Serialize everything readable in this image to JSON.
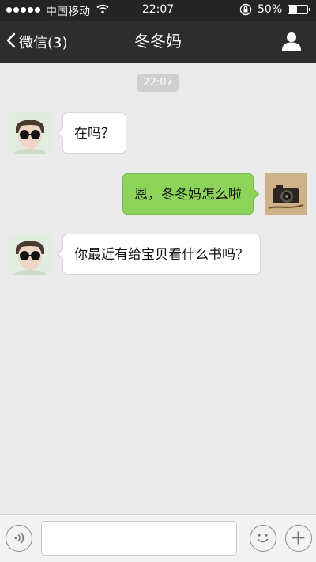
{
  "status_bar": {
    "carrier": "中国移动",
    "time": "22:07",
    "battery": "50%",
    "battery_level": 0.5
  },
  "nav": {
    "back_label": "微信(3)",
    "title": "冬冬妈"
  },
  "chat": {
    "timestamp": "22:07",
    "messages": [
      {
        "direction": "incoming",
        "text": "在吗？"
      },
      {
        "direction": "outgoing",
        "text": "恩，冬冬妈怎么啦"
      },
      {
        "direction": "incoming",
        "text": "你最近有给宝贝看什么书吗？"
      }
    ]
  },
  "input_bar": {
    "text_value": "",
    "icons": [
      "voice-icon",
      "emoji-icon",
      "plus-icon"
    ]
  },
  "colors": {
    "header_bg": "#2d2d2e",
    "chat_bg": "#ebebeb",
    "outgoing_bubble": "#8fd45a",
    "incoming_bubble": "#ffffff"
  }
}
